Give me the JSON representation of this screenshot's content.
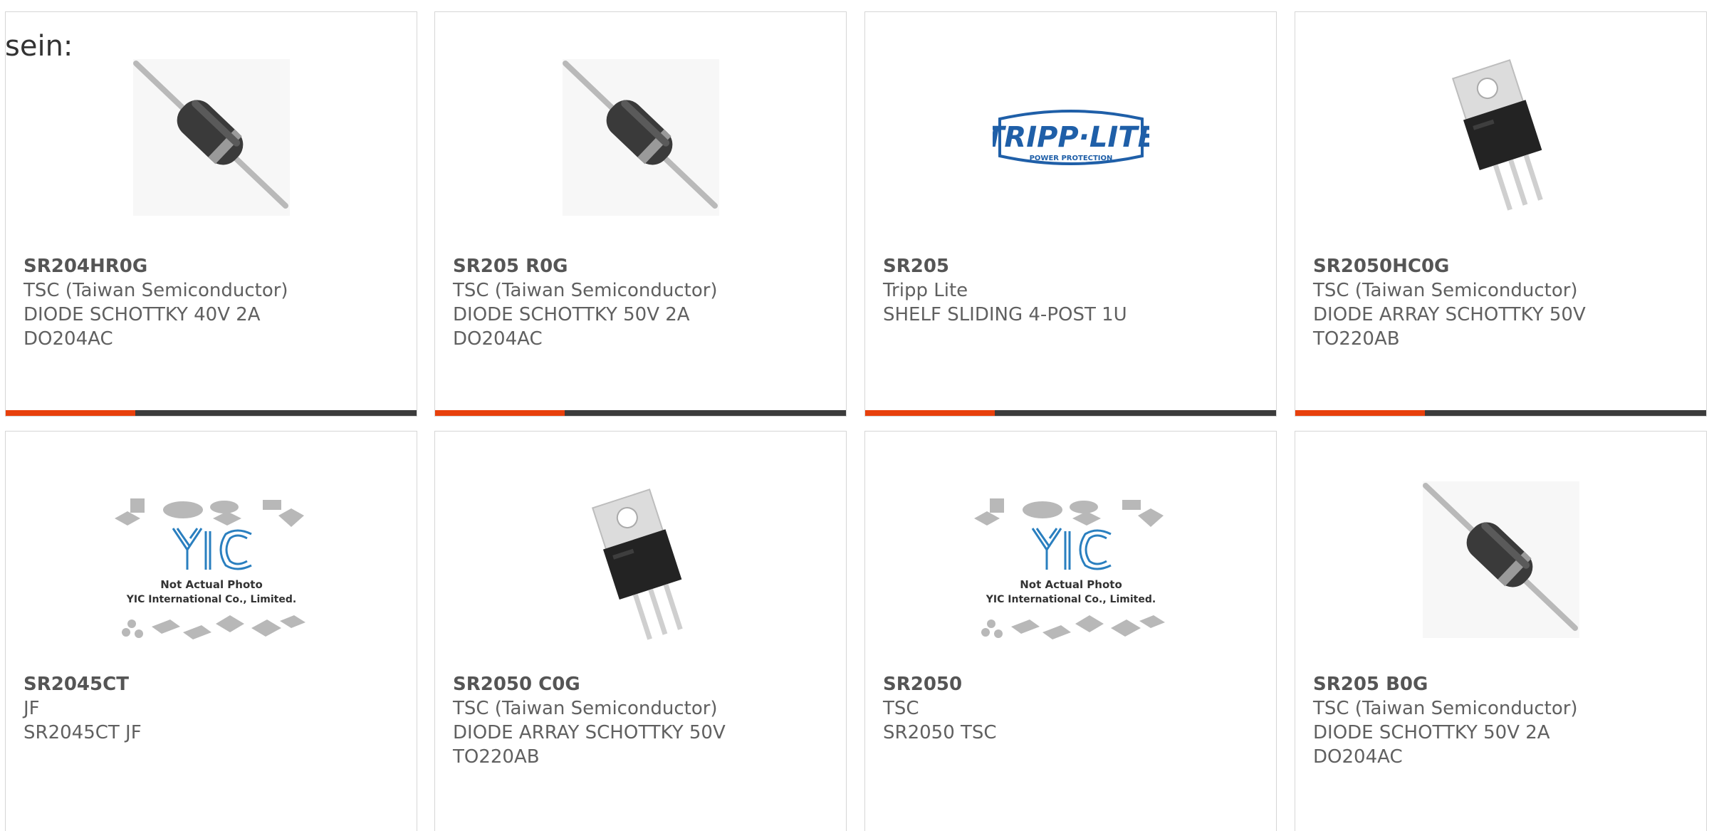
{
  "lead_text": "sein:",
  "colors": {
    "accent": "#e8400c",
    "bar": "#3b3b3b",
    "border": "#d6d6d6",
    "text": "#606060",
    "brand_blue": "#1f5fa8"
  },
  "products": [
    {
      "part": "SR204HR0G",
      "maker": "TSC (Taiwan Semiconductor)",
      "desc1": "DIODE SCHOTTKY 40V 2A",
      "desc2": "DO204AC",
      "image": "axial-diode-image"
    },
    {
      "part": "SR205 R0G",
      "maker": "TSC (Taiwan Semiconductor)",
      "desc1": "DIODE SCHOTTKY 50V 2A",
      "desc2": "DO204AC",
      "image": "axial-diode-image"
    },
    {
      "part": "SR205",
      "maker": "Tripp Lite",
      "desc1": "SHELF SLIDING 4-POST 1U",
      "desc2": "",
      "image": "tripp-lite-logo",
      "logo_text": "TRIPP·LITE",
      "logo_sub": "POWER PROTECTION"
    },
    {
      "part": "SR2050HC0G",
      "maker": "TSC (Taiwan Semiconductor)",
      "desc1": "DIODE ARRAY SCHOTTKY 50V",
      "desc2": "TO220AB",
      "image": "to220-package-image"
    },
    {
      "part": "SR2045CT",
      "maker": "JF",
      "desc1": "SR2045CT JF",
      "desc2": "",
      "image": "not-actual-photo-placeholder",
      "ph_line1": "Not Actual Photo",
      "ph_line2": "YIC International Co., Limited."
    },
    {
      "part": "SR2050 C0G",
      "maker": "TSC (Taiwan Semiconductor)",
      "desc1": "DIODE ARRAY SCHOTTKY 50V",
      "desc2": "TO220AB",
      "image": "to220-package-image"
    },
    {
      "part": "SR2050",
      "maker": "TSC",
      "desc1": "SR2050 TSC",
      "desc2": "",
      "image": "not-actual-photo-placeholder",
      "ph_line1": "Not Actual Photo",
      "ph_line2": "YIC International Co., Limited."
    },
    {
      "part": "SR205 B0G",
      "maker": "TSC (Taiwan Semiconductor)",
      "desc1": "DIODE SCHOTTKY 50V 2A",
      "desc2": "DO204AC",
      "image": "axial-diode-image"
    }
  ]
}
